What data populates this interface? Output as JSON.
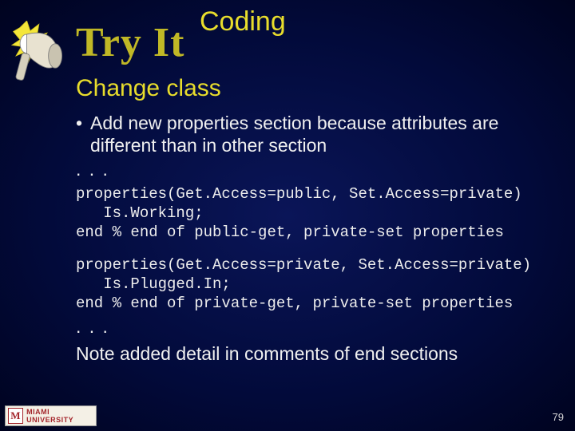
{
  "header": {
    "coding": "Coding",
    "try_it": "Try It"
  },
  "subtitle": "Change class",
  "bullet": {
    "mark": "•",
    "text": "Add new properties section because attributes are different than in other section"
  },
  "ellipsis": ". . .",
  "code_block_1": "properties(Get.Access=public, Set.Access=private)\n   Is.Working;\nend % end of public-get, private-set properties",
  "code_block_2": "properties(Get.Access=private, Set.Access=private)\n   Is.Plugged.In;\nend % end of private-get, private-set properties",
  "note": "Note added detail in comments of end sections",
  "page_number": "79",
  "logo": {
    "letter": "M",
    "text": "MIAMI UNIVERSITY"
  }
}
